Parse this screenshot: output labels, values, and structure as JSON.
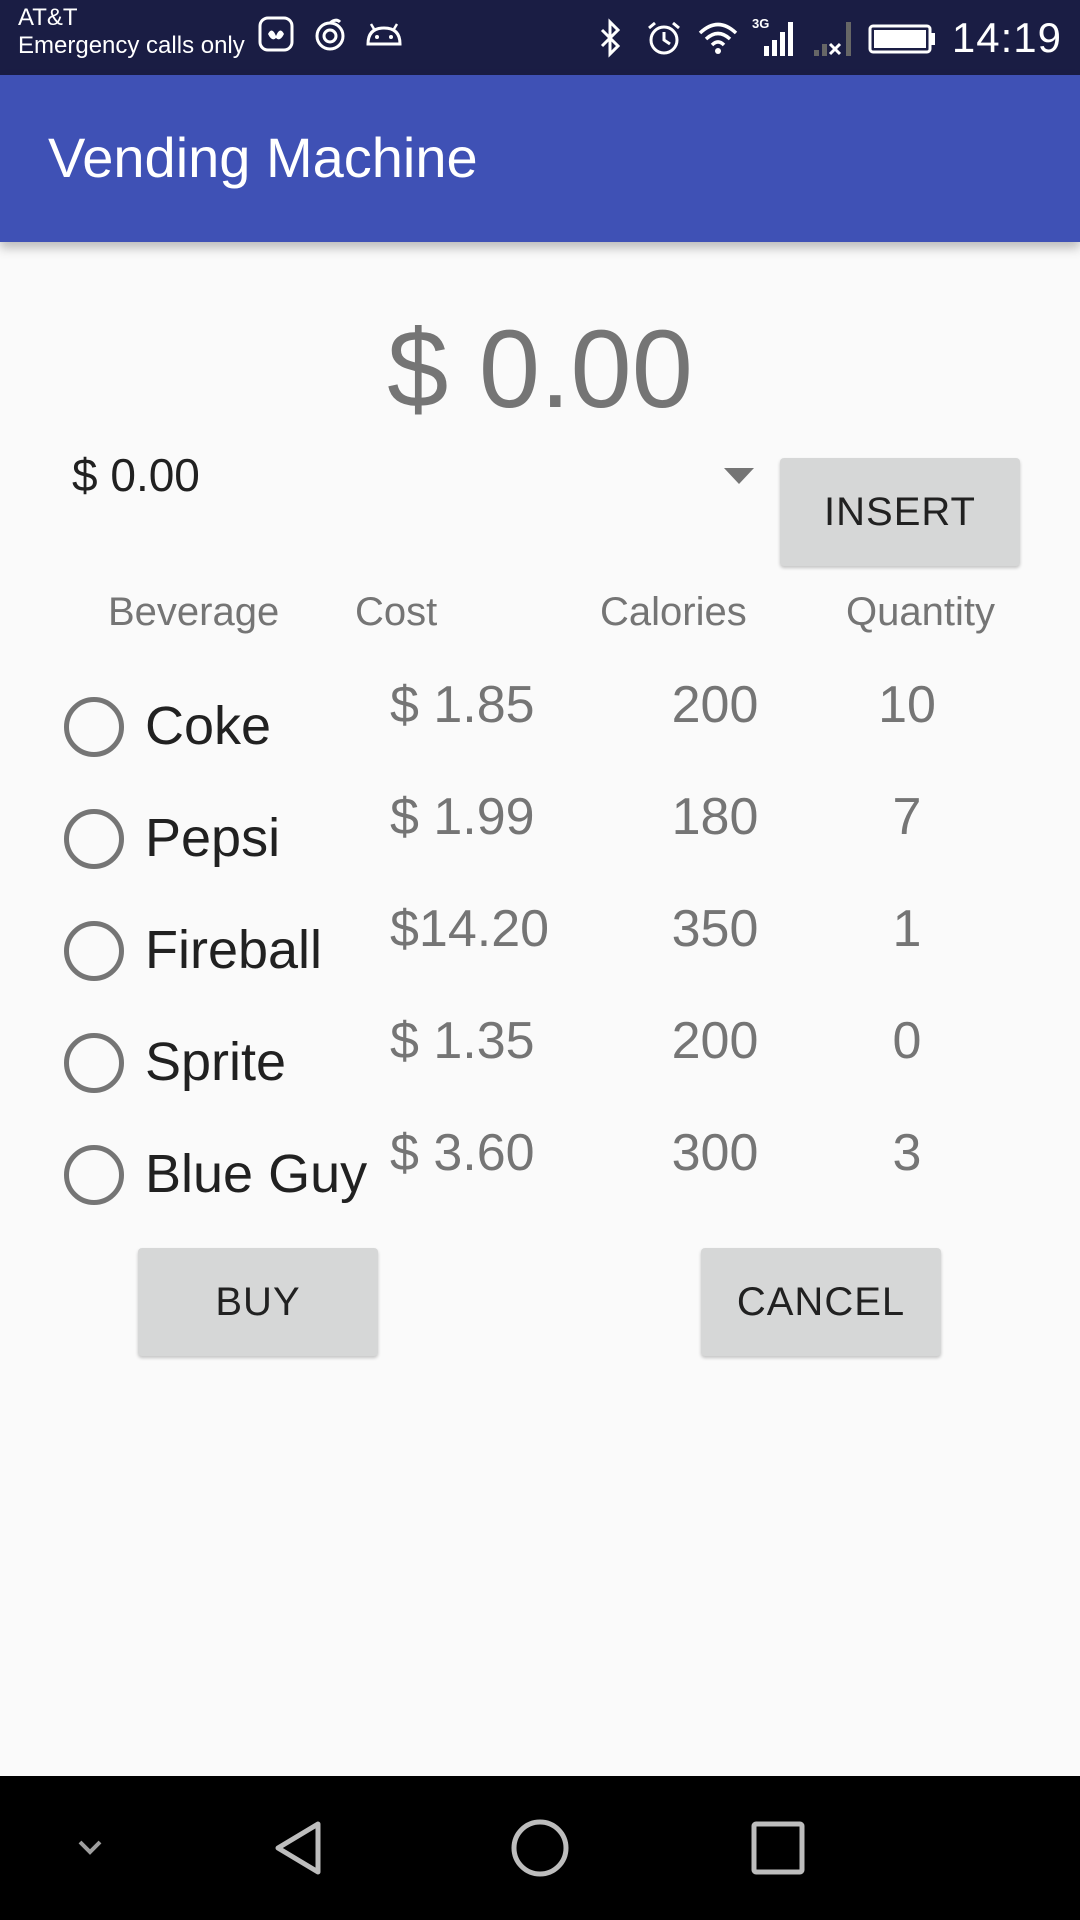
{
  "status_bar": {
    "carrier": "AT&T",
    "carrier_status": "Emergency calls only",
    "network": "3G",
    "time": "14:19",
    "icons_left": [
      "huawei-icon",
      "swirl-icon",
      "android-icon"
    ],
    "icons_right": [
      "bluetooth-icon",
      "alarm-icon",
      "wifi-icon",
      "signal-3g-icon",
      "signal-no-service-icon",
      "battery-icon"
    ]
  },
  "app_bar": {
    "title": "Vending Machine",
    "color": "#3f51b5"
  },
  "balance": {
    "display": "$ 0.00"
  },
  "coin_spinner": {
    "selected": "$ 0.00"
  },
  "buttons": {
    "insert": "INSERT",
    "buy": "BUY",
    "cancel": "CANCEL"
  },
  "table": {
    "headers": {
      "beverage": "Beverage",
      "cost": "Cost",
      "calories": "Calories",
      "quantity": "Quantity"
    },
    "rows": [
      {
        "name": "Coke",
        "cost": "$ 1.85",
        "calories": "200",
        "quantity": "10",
        "selected": false
      },
      {
        "name": "Pepsi",
        "cost": "$ 1.99",
        "calories": "180",
        "quantity": "7",
        "selected": false
      },
      {
        "name": "Fireball",
        "cost": "$14.20",
        "calories": "350",
        "quantity": "1",
        "selected": false
      },
      {
        "name": "Sprite",
        "cost": "$ 1.35",
        "calories": "200",
        "quantity": "0",
        "selected": false
      },
      {
        "name": "Blue Guy",
        "cost": "$ 3.60",
        "calories": "300",
        "quantity": "3",
        "selected": false
      }
    ]
  },
  "nav_bar": {
    "buttons": [
      "hide-keyboard-icon",
      "back-icon",
      "home-icon",
      "recents-icon"
    ]
  }
}
